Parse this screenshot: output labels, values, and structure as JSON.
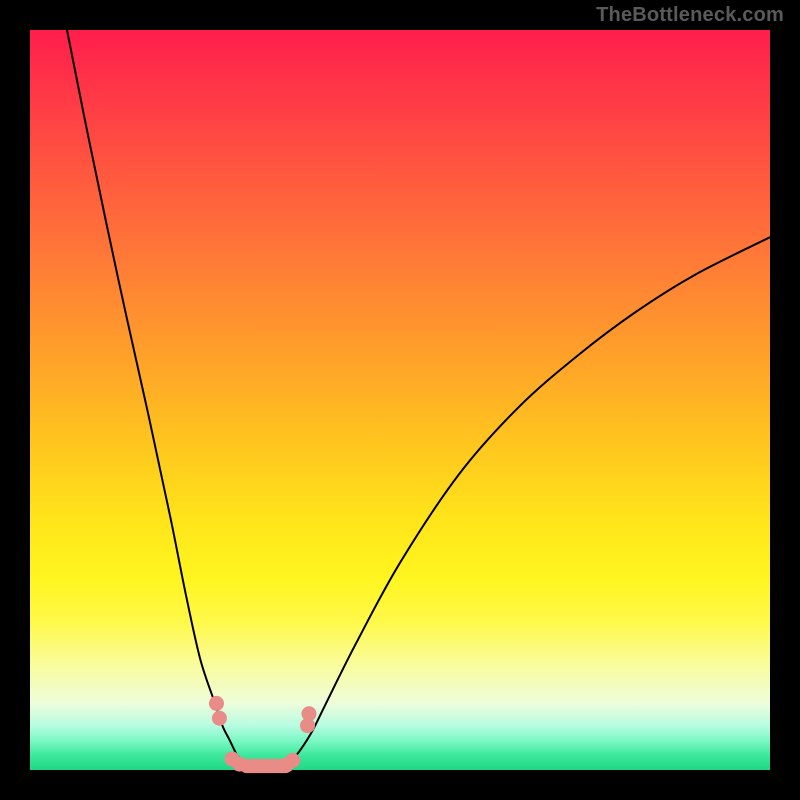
{
  "watermark": {
    "text": "TheBottleneck.com"
  },
  "colors": {
    "page_bg": "#000000",
    "watermark": "#5a5a5a",
    "curve": "#000000",
    "marker": "#e98b87"
  },
  "chart_data": {
    "type": "line",
    "title": "",
    "xlabel": "",
    "ylabel": "",
    "xlim": [
      0,
      100
    ],
    "ylim": [
      0,
      100
    ],
    "grid": false,
    "legend": false,
    "series": [
      {
        "name": "left-branch",
        "x": [
          5,
          8,
          12,
          16,
          19,
          21,
          23,
          25,
          26,
          27,
          28,
          29,
          31
        ],
        "values": [
          100,
          85,
          66,
          48,
          34,
          24,
          15,
          9,
          6,
          4,
          2,
          1,
          0
        ]
      },
      {
        "name": "right-branch",
        "x": [
          34,
          36,
          38,
          40,
          44,
          50,
          58,
          66,
          74,
          82,
          90,
          100
        ],
        "values": [
          0,
          2,
          5,
          9,
          17,
          28,
          40,
          49,
          56,
          62,
          67,
          72
        ]
      }
    ],
    "trough": {
      "x_start": 26,
      "x_end": 36,
      "y": 0
    },
    "markers": [
      {
        "x": 25.2,
        "y": 9
      },
      {
        "x": 25.6,
        "y": 7
      },
      {
        "x": 27.3,
        "y": 1.5
      },
      {
        "x": 28.3,
        "y": 0.8
      },
      {
        "x": 34.7,
        "y": 0.7
      },
      {
        "x": 35.5,
        "y": 1.3
      },
      {
        "x": 37.5,
        "y": 6
      },
      {
        "x": 37.7,
        "y": 7.6
      }
    ],
    "marker_bar": {
      "x_start": 28.3,
      "x_end": 35.5,
      "y": 0.3,
      "thickness": 1.2
    }
  }
}
